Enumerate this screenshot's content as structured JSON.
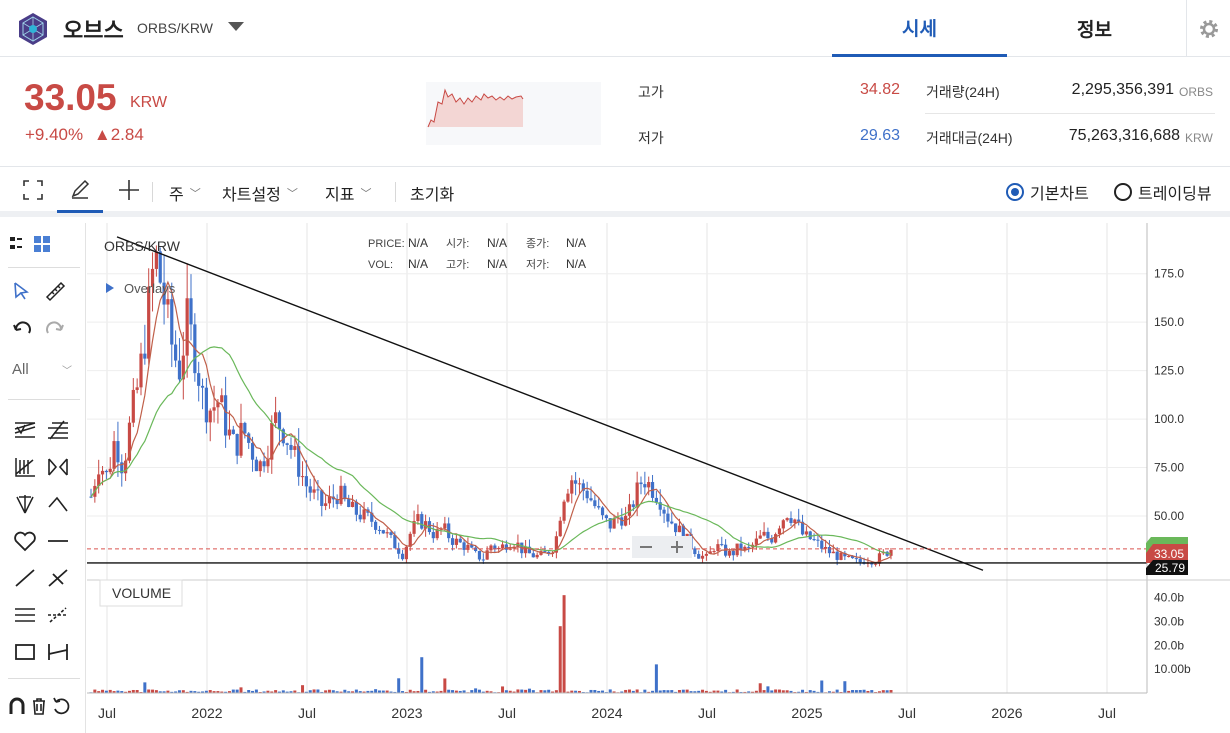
{
  "header": {
    "coin_name": "오브스",
    "pair": "ORBS/KRW",
    "tabs": [
      {
        "label": "시세",
        "active": true
      },
      {
        "label": "정보",
        "active": false
      }
    ]
  },
  "ticker": {
    "price": "33.05",
    "unit": "KRW",
    "change_pct": "+9.40%",
    "change_abs": "▲2.84",
    "high_label": "고가",
    "high_value": "34.82",
    "low_label": "저가",
    "low_value": "29.63",
    "volume_label": "거래량(24H)",
    "volume_value": "2,295,356,391",
    "volume_unit": "ORBS",
    "amount_label": "거래대금(24H)",
    "amount_value": "75,263,316,688",
    "amount_unit": "KRW"
  },
  "toolbar": {
    "interval": "주",
    "chart_settings": "차트설정",
    "indicators": "지표",
    "reset": "초기화",
    "basic_chart": "기본차트",
    "trading_view": "트레이딩뷰",
    "selected_mode": "기본차트"
  },
  "left_tools": {
    "filter": "All"
  },
  "chart": {
    "symbol": "ORBS/KRW",
    "overlays": "Overlays",
    "legend": {
      "price_label": "PRICE:",
      "price_val": "N/A",
      "open_label": "시가:",
      "open_val": "N/A",
      "close_label": "종가:",
      "close_val": "N/A",
      "vol_label": "VOL:",
      "vol_val": "N/A",
      "high_label": "고가:",
      "high_val": "N/A",
      "low_label": "저가:",
      "low_val": "N/A"
    },
    "volume_label": "VOLUME",
    "last_price_tag": "33.05",
    "hline_tag": "25.79",
    "colors": {
      "up": "#c84a45",
      "down": "#3f71c9",
      "ma_short": "#c0604a",
      "ma_long": "#6ab85a",
      "accent": "#1f5bb6"
    }
  },
  "chart_data": {
    "type": "candlestick",
    "title": "ORBS/KRW",
    "y_ticks": [
      "175.0",
      "150.0",
      "125.0",
      "100.0",
      "75.00",
      "50.00"
    ],
    "ylim": [
      18,
      196
    ],
    "volume_ticks": [
      "40.0b",
      "30.0b",
      "20.0b",
      "10.00b"
    ],
    "volume_ylim": [
      0,
      44
    ],
    "x_ticks": [
      "Jul",
      "2022",
      "Jul",
      "2023",
      "Jul",
      "2024",
      "Jul",
      "2025",
      "Jul",
      "2026",
      "Jul"
    ],
    "x_range": [
      2021.4,
      2026.7
    ],
    "price_series": [
      [
        2021.42,
        60
      ],
      [
        2021.46,
        78
      ],
      [
        2021.5,
        70
      ],
      [
        2021.54,
        90
      ],
      [
        2021.58,
        75
      ],
      [
        2021.62,
        100
      ],
      [
        2021.66,
        120
      ],
      [
        2021.7,
        150
      ],
      [
        2021.74,
        185
      ],
      [
        2021.78,
        165
      ],
      [
        2021.82,
        140
      ],
      [
        2021.86,
        125
      ],
      [
        2021.9,
        150
      ],
      [
        2021.94,
        135
      ],
      [
        2021.98,
        110
      ],
      [
        2022.02,
        105
      ],
      [
        2022.06,
        110
      ],
      [
        2022.1,
        95
      ],
      [
        2022.14,
        85
      ],
      [
        2022.18,
        95
      ],
      [
        2022.22,
        85
      ],
      [
        2022.26,
        75
      ],
      [
        2022.3,
        85
      ],
      [
        2022.34,
        100
      ],
      [
        2022.38,
        95
      ],
      [
        2022.42,
        85
      ],
      [
        2022.46,
        75
      ],
      [
        2022.5,
        65
      ],
      [
        2022.54,
        60
      ],
      [
        2022.58,
        55
      ],
      [
        2022.62,
        58
      ],
      [
        2022.66,
        62
      ],
      [
        2022.7,
        55
      ],
      [
        2022.74,
        52
      ],
      [
        2022.78,
        50
      ],
      [
        2022.82,
        48
      ],
      [
        2022.86,
        45
      ],
      [
        2022.9,
        40
      ],
      [
        2022.94,
        35
      ],
      [
        2022.98,
        30
      ],
      [
        2023.02,
        42
      ],
      [
        2023.06,
        48
      ],
      [
        2023.1,
        45
      ],
      [
        2023.14,
        40
      ],
      [
        2023.18,
        44
      ],
      [
        2023.22,
        38
      ],
      [
        2023.26,
        36
      ],
      [
        2023.3,
        34
      ],
      [
        2023.34,
        30
      ],
      [
        2023.38,
        28
      ],
      [
        2023.42,
        35
      ],
      [
        2023.46,
        33
      ],
      [
        2023.5,
        36
      ],
      [
        2023.54,
        37
      ],
      [
        2023.58,
        32
      ],
      [
        2023.62,
        30
      ],
      [
        2023.66,
        29
      ],
      [
        2023.7,
        31
      ],
      [
        2023.74,
        35
      ],
      [
        2023.78,
        60
      ],
      [
        2023.82,
        70
      ],
      [
        2023.86,
        65
      ],
      [
        2023.9,
        62
      ],
      [
        2023.94,
        55
      ],
      [
        2023.98,
        48
      ],
      [
        2024.02,
        45
      ],
      [
        2024.06,
        50
      ],
      [
        2024.1,
        48
      ],
      [
        2024.14,
        60
      ],
      [
        2024.18,
        70
      ],
      [
        2024.22,
        65
      ],
      [
        2024.26,
        60
      ],
      [
        2024.3,
        50
      ],
      [
        2024.34,
        45
      ],
      [
        2024.38,
        40
      ],
      [
        2024.42,
        35
      ],
      [
        2024.46,
        30
      ],
      [
        2024.5,
        28
      ],
      [
        2024.54,
        35
      ],
      [
        2024.58,
        32
      ],
      [
        2024.62,
        30
      ],
      [
        2024.66,
        34
      ],
      [
        2024.7,
        32
      ],
      [
        2024.74,
        36
      ],
      [
        2024.78,
        40
      ],
      [
        2024.82,
        38
      ],
      [
        2024.86,
        46
      ],
      [
        2024.9,
        52
      ],
      [
        2024.94,
        48
      ],
      [
        2024.98,
        40
      ],
      [
        2025.02,
        38
      ],
      [
        2025.06,
        35
      ],
      [
        2025.1,
        32
      ],
      [
        2025.14,
        30
      ],
      [
        2025.18,
        28
      ],
      [
        2025.22,
        27
      ],
      [
        2025.26,
        26
      ],
      [
        2025.3,
        28
      ],
      [
        2025.34,
        27
      ],
      [
        2025.38,
        30
      ],
      [
        2025.42,
        33.05
      ]
    ],
    "trendline": [
      [
        2021.55,
        194
      ],
      [
        2025.88,
        22
      ]
    ],
    "horizontal_line": 25.79,
    "last_price": 33.05
  }
}
